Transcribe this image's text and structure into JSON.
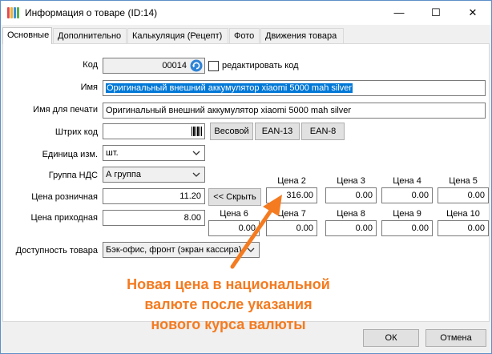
{
  "window": {
    "title": "Информация о товаре (ID:14)",
    "minimize_glyph": "—",
    "maximize_glyph": "☐",
    "close_glyph": "✕"
  },
  "tabs": [
    "Основные",
    "Дополнительно",
    "Калькуляция (Рецепт)",
    "Фото",
    "Движения товара"
  ],
  "active_tab": "Основные",
  "form": {
    "code": {
      "label": "Код",
      "value": "00014"
    },
    "edit_code": {
      "label": "редактировать код",
      "checked": false
    },
    "name": {
      "label": "Имя",
      "value": "Оригинальный внешний аккумулятор xiaomi 5000 mah silver"
    },
    "print_name": {
      "label": "Имя для печати",
      "value": "Оригинальный внешний аккумулятор xiaomi 5000 mah silver"
    },
    "barcode": {
      "label": "Штрих код",
      "value": ""
    },
    "barcode_buttons": [
      "Весовой",
      "EAN-13",
      "EAN-8"
    ],
    "unit": {
      "label": "Единица изм.",
      "value": "шт."
    },
    "vat_group": {
      "label": "Группа НДС",
      "value": "А группа"
    },
    "retail_price": {
      "label": "Цена розничная",
      "value": "11.20"
    },
    "purchase_price": {
      "label": "Цена приходная",
      "value": "8.00"
    },
    "hide_button": "<< Скрыть",
    "prices_row1": [
      {
        "label": "Цена 2",
        "value": "316.00"
      },
      {
        "label": "Цена 3",
        "value": "0.00"
      },
      {
        "label": "Цена 4",
        "value": "0.00"
      },
      {
        "label": "Цена 5",
        "value": "0.00"
      }
    ],
    "prices_row2": [
      {
        "label": "Цена 6",
        "value": "0.00"
      },
      {
        "label": "Цена 7",
        "value": "0.00"
      },
      {
        "label": "Цена 8",
        "value": "0.00"
      },
      {
        "label": "Цена 9",
        "value": "0.00"
      },
      {
        "label": "Цена 10",
        "value": "0.00"
      }
    ],
    "availability": {
      "label": "Доступность товара",
      "value": "Бэк-офис, фронт (экран кассира)"
    }
  },
  "annotation": {
    "lines": [
      "Новая цена в национальной",
      "валюте после указания",
      "нового курса валюты"
    ],
    "color": "#f47b20"
  },
  "footer": {
    "ok": "ОК",
    "cancel": "Отмена"
  },
  "colors": {
    "accent": "#0078d7",
    "annotation": "#f47b20"
  }
}
